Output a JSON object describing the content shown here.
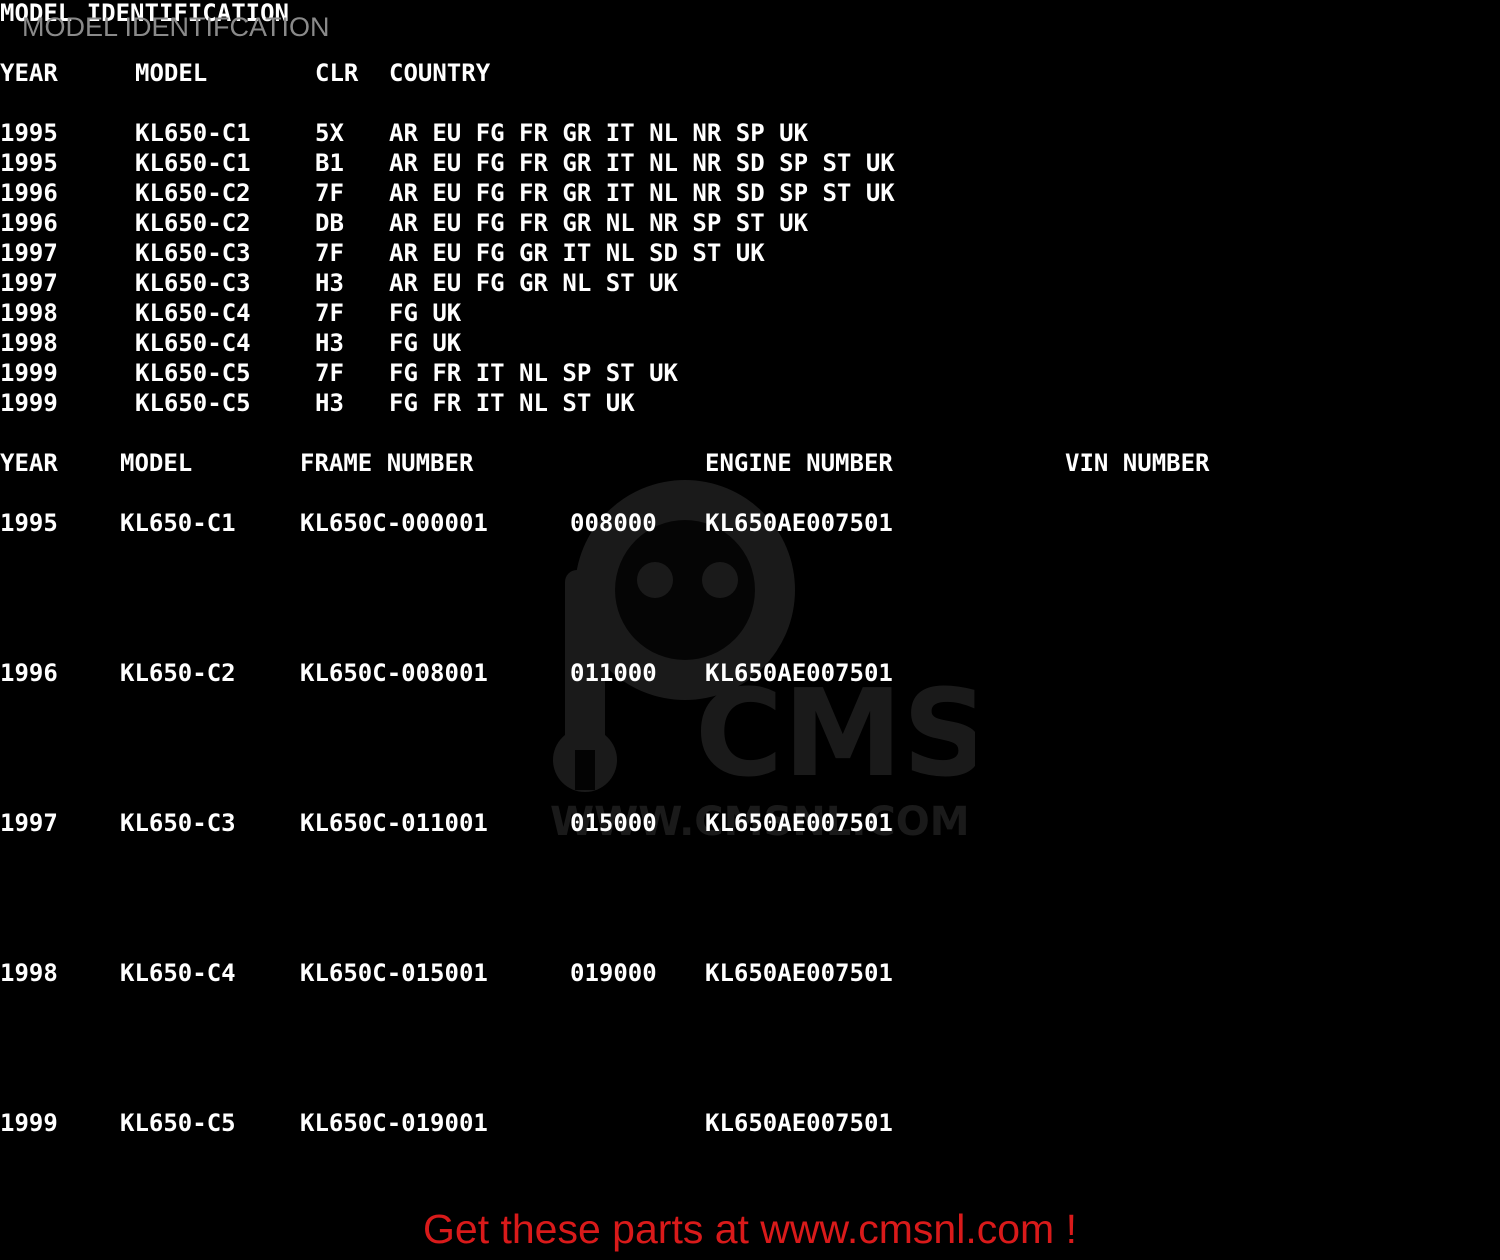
{
  "doc_title": "MODEL IDENTIFICATION",
  "overlay_title": "MODEL IDENTIFCATION",
  "table1": {
    "headers": {
      "year": "YEAR",
      "model": "MODEL",
      "clr": "CLR",
      "country": "COUNTRY"
    },
    "rows": [
      {
        "year": "1995",
        "model": "KL650-C1",
        "clr": "5X",
        "country": "AR EU FG FR GR IT NL NR SP UK"
      },
      {
        "year": "1995",
        "model": "KL650-C1",
        "clr": "B1",
        "country": "AR EU FG FR GR IT NL NR SD SP ST UK"
      },
      {
        "year": "1996",
        "model": "KL650-C2",
        "clr": "7F",
        "country": "AR EU FG FR GR IT NL NR SD SP ST UK"
      },
      {
        "year": "1996",
        "model": "KL650-C2",
        "clr": "DB",
        "country": "AR EU FG FR GR NL NR SP ST UK"
      },
      {
        "year": "1997",
        "model": "KL650-C3",
        "clr": "7F",
        "country": "AR EU FG GR IT NL SD ST UK"
      },
      {
        "year": "1997",
        "model": "KL650-C3",
        "clr": "H3",
        "country": "AR EU FG GR NL ST UK"
      },
      {
        "year": "1998",
        "model": "KL650-C4",
        "clr": "7F",
        "country": "FG UK"
      },
      {
        "year": "1998",
        "model": "KL650-C4",
        "clr": "H3",
        "country": "FG UK"
      },
      {
        "year": "1999",
        "model": "KL650-C5",
        "clr": "7F",
        "country": "FG FR IT NL SP ST UK"
      },
      {
        "year": "1999",
        "model": "KL650-C5",
        "clr": "H3",
        "country": "FG FR IT NL ST UK"
      }
    ]
  },
  "table2": {
    "headers": {
      "year": "YEAR",
      "model": "MODEL",
      "frame": "FRAME NUMBER",
      "engine": "ENGINE NUMBER",
      "vin": "VIN NUMBER"
    },
    "rows": [
      {
        "year": "1995",
        "model": "KL650-C1",
        "frame": "KL650C-000001",
        "frame_end": "008000",
        "engine": "KL650AE007501"
      },
      {
        "year": "1996",
        "model": "KL650-C2",
        "frame": "KL650C-008001",
        "frame_end": "011000",
        "engine": "KL650AE007501"
      },
      {
        "year": "1997",
        "model": "KL650-C3",
        "frame": "KL650C-011001",
        "frame_end": "015000",
        "engine": "KL650AE007501"
      },
      {
        "year": "1998",
        "model": "KL650-C4",
        "frame": "KL650C-015001",
        "frame_end": "019000",
        "engine": "KL650AE007501"
      },
      {
        "year": "1999",
        "model": "KL650-C5",
        "frame": "KL650C-019001",
        "frame_end": "",
        "engine": "KL650AE007501"
      }
    ]
  },
  "watermark": {
    "logo_text": "CMS",
    "url_text": "WWW.CMSNL.COM"
  },
  "footer": {
    "text": "Get these parts at www.cmsnl.com !",
    "color": "#d91a1a"
  }
}
